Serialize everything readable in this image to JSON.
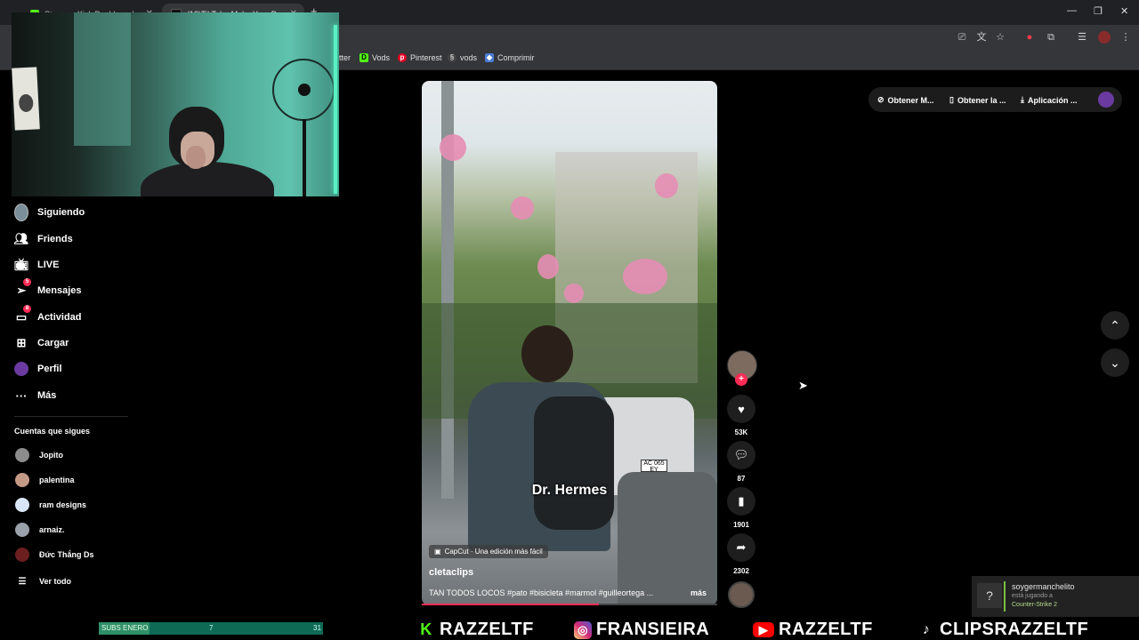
{
  "browser": {
    "tabs": [
      {
        "label": "Stream - Kick Dashboard"
      },
      {
        "label": "(12)TikTok - Make Your Day"
      }
    ],
    "new_tab": "+",
    "bookmarks": [
      {
        "label": "tter"
      },
      {
        "label": "Vods"
      },
      {
        "label": "Pinterest"
      },
      {
        "label": "vods"
      },
      {
        "label": "Comprimir"
      }
    ]
  },
  "sidebar": {
    "nav": [
      {
        "label": "Siguiendo",
        "icon": "avatar-icon"
      },
      {
        "label": "Friends",
        "icon": "friends-icon"
      },
      {
        "label": "LIVE",
        "icon": "live-tv-icon"
      },
      {
        "label": "Mensajes",
        "icon": "paper-plane-icon",
        "badge": "5"
      },
      {
        "label": "Actividad",
        "icon": "activity-icon",
        "badge": "8"
      },
      {
        "label": "Cargar",
        "icon": "upload-plus-icon"
      },
      {
        "label": "Perfil",
        "icon": "profile-avatar-icon"
      },
      {
        "label": "Más",
        "icon": "more-dots-icon"
      }
    ],
    "following_title": "Cuentas que sigues",
    "following": [
      {
        "name": "Jopito"
      },
      {
        "name": "palentina"
      },
      {
        "name": "ram designs"
      },
      {
        "name": "arnaiz."
      },
      {
        "name": "Đức Thắng Ds"
      }
    ],
    "see_all": "Ver todo"
  },
  "video": {
    "caption_overlay": "Dr. Hermes",
    "capcut_label": "CapCut · Una edición más fácil",
    "author": "cletaclips",
    "description": "TAN TODOS LOCOS #pato #bisicleta #marmol #guilleortega ...",
    "more_label": "más",
    "progress": 0.6
  },
  "actions": {
    "likes": "53K",
    "comments": "87",
    "saves": "1901",
    "shares": "2302"
  },
  "topbar": {
    "btn1": "Obtener M...",
    "btn2": "Obtener la ...",
    "btn3": "Aplicación ..."
  },
  "notification": {
    "user": "soygermanchelito",
    "action": "está jugando a",
    "game": "Counter-Strike 2",
    "icon": "?"
  },
  "overlay": {
    "subs_label": "SUBS ENERO",
    "subs_current": "7",
    "subs_goal": "31",
    "socials": [
      {
        "icon": "kick-icon",
        "handle": "RAZZELTF",
        "color": "#53fc18"
      },
      {
        "icon": "instagram-icon",
        "handle": "FRANSIEIRA",
        "color": "#d62976"
      },
      {
        "icon": "youtube-icon",
        "handle": "RAZZELTF",
        "color": "#ff0000"
      },
      {
        "icon": "tiktok-icon",
        "handle": "CLIPSRAZZELTF",
        "color": "#ffffff"
      }
    ]
  },
  "colors": {
    "accent": "#fe2c55",
    "background": "#000000",
    "kick_green": "#53fc18"
  }
}
